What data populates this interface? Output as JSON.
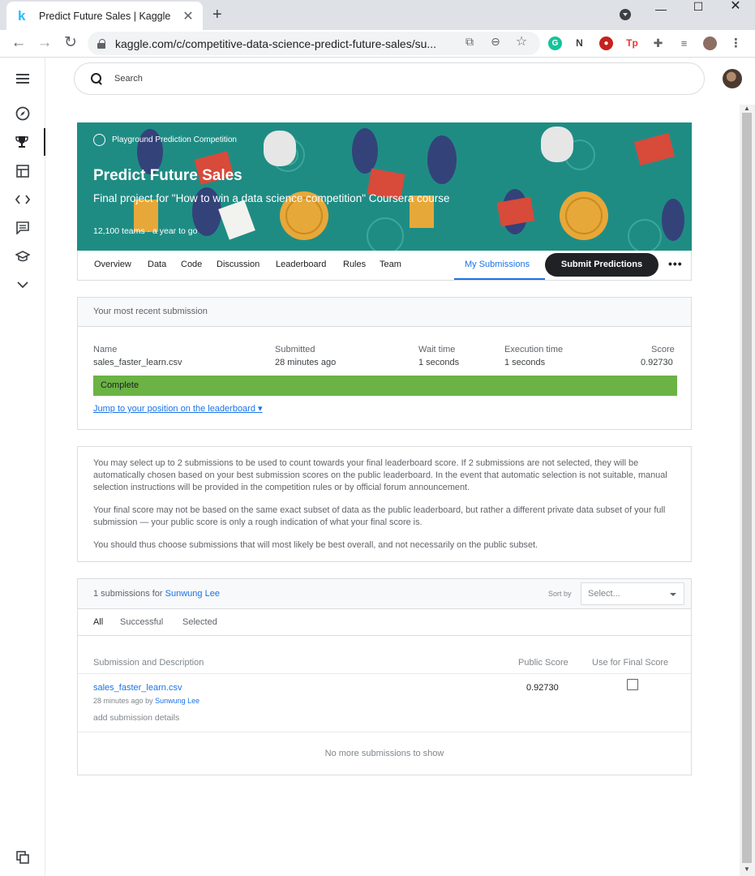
{
  "browser": {
    "tab_title": "Predict Future Sales | Kaggle",
    "url": "kaggle.com/c/competitive-data-science-predict-future-sales/su..."
  },
  "search": {
    "placeholder": "Search"
  },
  "banner": {
    "badge": "Playground Prediction Competition",
    "title": "Predict Future Sales",
    "subtitle": "Final project for \"How to win a data science competition\" Coursera course",
    "teams": "12,100 teams",
    "time_left": "a year to go",
    "bg_color": "#1f8c84"
  },
  "nav": {
    "overview": "Overview",
    "data": "Data",
    "code": "Code",
    "discussion": "Discussion",
    "leaderboard": "Leaderboard",
    "rules": "Rules",
    "team": "Team",
    "my_submissions": "My Submissions",
    "submit": "Submit Predictions"
  },
  "recent": {
    "heading": "Your most recent submission",
    "labels": {
      "name": "Name",
      "submitted": "Submitted",
      "wait": "Wait time",
      "execution": "Execution time",
      "score": "Score"
    },
    "values": {
      "name": "sales_faster_learn.csv",
      "submitted": "28 minutes ago",
      "wait": "1 seconds",
      "execution": "1 seconds",
      "score": "0.92730"
    },
    "status": "Complete",
    "status_color": "#6ab344",
    "jump_link": "Jump to your position on the leaderboard"
  },
  "info": {
    "p1": "You may select up to 2 submissions to be used to count towards your final leaderboard score. If 2 submissions are not selected, they will be automatically chosen based on your best submission scores on the public leaderboard. In the event that automatic selection is not suitable, manual selection instructions will be provided in the competition rules or by official forum announcement.",
    "p2": "Your final score may not be based on the same exact subset of data as the public leaderboard, but rather a different private data subset of your full submission — your public score is only a rough indication of what your final score is.",
    "p3": "You should thus choose submissions that will most likely be best overall, and not necessarily on the public subset."
  },
  "submissions": {
    "count_text": "1 submissions for",
    "user": "Sunwung Lee",
    "sort_label": "Sort by",
    "sort_placeholder": "Select...",
    "filters": {
      "all": "All",
      "successful": "Successful",
      "selected": "Selected"
    },
    "columns": {
      "desc": "Submission and Description",
      "public": "Public Score",
      "final": "Use for Final Score"
    },
    "rows": [
      {
        "file": "sales_faster_learn.csv",
        "when": "28 minutes ago",
        "by": "by",
        "user": "Sunwung Lee",
        "details": "add submission details",
        "score": "0.92730"
      }
    ],
    "no_more": "No more submissions to show"
  }
}
